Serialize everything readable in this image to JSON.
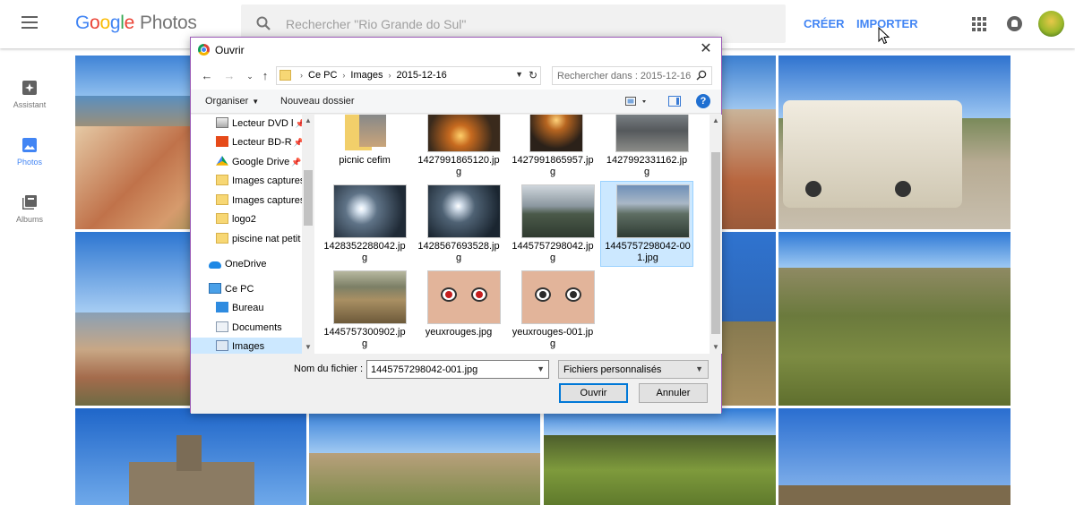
{
  "header": {
    "logo_google": [
      "G",
      "o",
      "o",
      "g",
      "l",
      "e"
    ],
    "logo_product": "Photos",
    "search_placeholder": "Rechercher \"Rio Grande do Sul\"",
    "create_label": "CRÉER",
    "import_label": "IMPORTER"
  },
  "leftnav": {
    "items": [
      {
        "label": "Assistant",
        "icon": "assistant-icon"
      },
      {
        "label": "Photos",
        "icon": "photos-icon",
        "active": true
      },
      {
        "label": "Albums",
        "icon": "albums-icon"
      }
    ]
  },
  "colors": {
    "accent": "#4285f4",
    "dialog_border": "#9b59b6",
    "selection": "#cce8ff"
  },
  "dialog": {
    "title": "Ouvrir",
    "close": "✕",
    "nav": {
      "back": "←",
      "forward": "→",
      "recent": "⌄",
      "up": "↑",
      "breadcrumb": [
        "Ce PC",
        "Images",
        "2015-12-16"
      ],
      "refresh": "↻",
      "search_placeholder": "Rechercher dans : 2015-12-16"
    },
    "toolbar": {
      "organize": "Organiser",
      "new_folder": "Nouveau dossier",
      "help": "?"
    },
    "tree": [
      {
        "label": "Lecteur DVD l",
        "icon": "dvd-drive-icon",
        "pinned": true
      },
      {
        "label": "Lecteur BD-R",
        "icon": "office-icon",
        "pinned": true
      },
      {
        "label": "Google Drive",
        "icon": "google-drive-icon",
        "pinned": true
      },
      {
        "label": "Images captures",
        "icon": "folder-icon"
      },
      {
        "label": "Images captures",
        "icon": "folder-icon"
      },
      {
        "label": "logo2",
        "icon": "folder-icon"
      },
      {
        "label": "piscine nat petit",
        "icon": "folder-icon"
      },
      {
        "label": "OneDrive",
        "icon": "onedrive-icon"
      },
      {
        "label": "Ce PC",
        "icon": "computer-icon"
      },
      {
        "label": "Bureau",
        "icon": "desktop-folder-icon"
      },
      {
        "label": "Documents",
        "icon": "documents-folder-icon"
      },
      {
        "label": "Images",
        "icon": "images-folder-icon",
        "selected": true
      }
    ],
    "files": [
      {
        "name": "picnic cefim",
        "kind": "folder"
      },
      {
        "name": "1427991865120.jpg",
        "kind": "sunset"
      },
      {
        "name": "1427991865957.jpg",
        "kind": "sunset2"
      },
      {
        "name": "1427992331162.jpg",
        "kind": "crowd"
      },
      {
        "name": "1428352288042.jpg",
        "kind": "sun"
      },
      {
        "name": "1428567693528.jpg",
        "kind": "sun"
      },
      {
        "name": "1445757298042.jpg",
        "kind": "lake"
      },
      {
        "name": "1445757298042-001.jpg",
        "kind": "lake2",
        "selected": true
      },
      {
        "name": "1445757300902.jpg",
        "kind": "river"
      },
      {
        "name": "yeuxrouges.jpg",
        "kind": "face"
      },
      {
        "name": "yeuxrouges-001.jpg",
        "kind": "face"
      }
    ],
    "footer": {
      "filename_label": "Nom du fichier :",
      "filename_value": "1445757298042-001.jpg",
      "filter_value": "Fichiers personnalisés",
      "open_label": "Ouvrir",
      "cancel_label": "Annuler"
    }
  }
}
